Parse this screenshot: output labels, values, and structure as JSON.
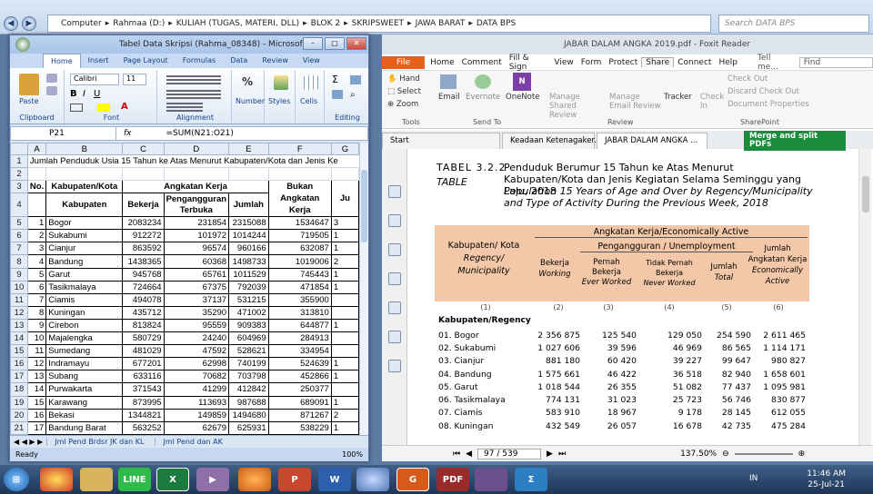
{
  "explorer": {
    "breadcrumb": [
      "Computer",
      "Rahmaa (D:)",
      "KULIAH (TUGAS, MATERI, DLL)",
      "BLOK 2",
      "SKRIPSWEET",
      "JAWA BARAT",
      "DATA BPS"
    ],
    "search_placeholder": "Search DATA BPS"
  },
  "excel": {
    "title": "Tabel Data Skripsi (Rahma_08348) - Microsoft E...",
    "tabs": [
      "Home",
      "Insert",
      "Page Layout",
      "Formulas",
      "Data",
      "Review",
      "View"
    ],
    "font_name": "Calibri",
    "font_size": "11",
    "groups": {
      "clipboard": "Clipboard",
      "font": "Font",
      "alignment": "Alignment",
      "editing": "Editing"
    },
    "paste": "Paste",
    "number": "Number",
    "styles": "Styles",
    "cells": "Cells",
    "cell_ref": "P21",
    "fx": "fx",
    "formula": "=SUM(N21:O21)",
    "columns": [
      "A",
      "B",
      "C",
      "D",
      "E",
      "F",
      "G"
    ],
    "row1_title": "Jumlah Penduduk Usia 15 Tahun ke Atas Menurut Kabupaten/Kota dan Jenis Ke",
    "head": {
      "no": "No.",
      "kabkota": "Kabupaten/Kota",
      "angkatan": "Angkatan Kerja",
      "kabupaten": "Kabupaten",
      "bekerja": "Bekerja",
      "pengangguran": "Pengangguran Terbuka",
      "jumlah": "Jumlah",
      "bukan": "Bukan Angkatan Kerja",
      "ju": "Ju"
    },
    "rows": [
      {
        "r": "5",
        "no": "1",
        "name": "Bogor",
        "c": "2083234",
        "d": "231854",
        "e": "2315088",
        "f": "1534647",
        "g": "3"
      },
      {
        "r": "6",
        "no": "2",
        "name": "Sukabumi",
        "c": "912272",
        "d": "101972",
        "e": "1014244",
        "f": "719505",
        "g": "1"
      },
      {
        "r": "7",
        "no": "3",
        "name": "Cianjur",
        "c": "863592",
        "d": "96574",
        "e": "960166",
        "f": "632087",
        "g": "1"
      },
      {
        "r": "8",
        "no": "4",
        "name": "Bandung",
        "c": "1438365",
        "d": "60368",
        "e": "1498733",
        "f": "1019006",
        "g": "2"
      },
      {
        "r": "9",
        "no": "5",
        "name": "Garut",
        "c": "945768",
        "d": "65761",
        "e": "1011529",
        "f": "745443",
        "g": "1"
      },
      {
        "r": "10",
        "no": "6",
        "name": "Tasikmalaya",
        "c": "724664",
        "d": "67375",
        "e": "792039",
        "f": "471854",
        "g": "1"
      },
      {
        "r": "11",
        "no": "7",
        "name": "Ciamis",
        "c": "494078",
        "d": "37137",
        "e": "531215",
        "f": "355900",
        "g": ""
      },
      {
        "r": "12",
        "no": "8",
        "name": "Kuningan",
        "c": "435712",
        "d": "35290",
        "e": "471002",
        "f": "313810",
        "g": ""
      },
      {
        "r": "13",
        "no": "9",
        "name": "Cirebon",
        "c": "813824",
        "d": "95559",
        "e": "909383",
        "f": "644877",
        "g": "1"
      },
      {
        "r": "14",
        "no": "10",
        "name": "Majalengka",
        "c": "580729",
        "d": "24240",
        "e": "604969",
        "f": "284913",
        "g": ""
      },
      {
        "r": "15",
        "no": "11",
        "name": "Sumedang",
        "c": "481029",
        "d": "47592",
        "e": "528621",
        "f": "334954",
        "g": ""
      },
      {
        "r": "16",
        "no": "12",
        "name": "Indramayu",
        "c": "677201",
        "d": "62998",
        "e": "740199",
        "f": "524639",
        "g": "1"
      },
      {
        "r": "17",
        "no": "13",
        "name": "Subang",
        "c": "633116",
        "d": "70682",
        "e": "703798",
        "f": "452866",
        "g": "1"
      },
      {
        "r": "18",
        "no": "14",
        "name": "Purwakarta",
        "c": "371543",
        "d": "41299",
        "e": "412842",
        "f": "250377",
        "g": ""
      },
      {
        "r": "19",
        "no": "15",
        "name": "Karawang",
        "c": "873995",
        "d": "113693",
        "e": "987688",
        "f": "689091",
        "g": "1"
      },
      {
        "r": "20",
        "no": "16",
        "name": "Bekasi",
        "c": "1344821",
        "d": "149859",
        "e": "1494680",
        "f": "871267",
        "g": "2"
      },
      {
        "r": "21",
        "no": "17",
        "name": "Bandung Barat",
        "c": "563252",
        "d": "62679",
        "e": "625931",
        "f": "538229",
        "g": "1"
      }
    ],
    "sheet_tabs": [
      "Jml Pend Brdsr JK dan KL",
      "Jml Pend dan AK"
    ],
    "status": "Ready",
    "zoom": "100%"
  },
  "foxit": {
    "title": "JABAR DALAM ANGKA 2019.pdf - Foxit Reader",
    "menu": [
      "File",
      "Home",
      "Comment",
      "Fill & Sign",
      "View",
      "Form",
      "Protect",
      "Share",
      "Connect",
      "Help"
    ],
    "tellme": "Tell me...",
    "find": "Find",
    "tools": {
      "hand": "Hand",
      "select": "Select",
      "zoom": "Zoom",
      "label": "Tools"
    },
    "sendto": {
      "email": "Email",
      "evernote": "Evernote",
      "onenote": "OneNote",
      "label": "Send To"
    },
    "review": {
      "shared": "Manage Shared Review",
      "email": "Manage Email Review",
      "tracker": "Tracker",
      "label": "Review"
    },
    "checkin": "Check In",
    "sharepoint": {
      "checkout": "Check Out",
      "discard": "Discard Check Out",
      "props": "Document Properties",
      "label": "SharePoint"
    },
    "tabs": [
      "Start",
      "Keadaan Ketenagaker...",
      "JABAR DALAM ANGKA ..."
    ],
    "merge": "Merge and split PDFs",
    "page": "97 / 539",
    "zoom": "137.50%",
    "pdf": {
      "table_no": "TABEL",
      "table_num": "3.2.2",
      "table_en": "TABLE",
      "title_id": "Penduduk Berumur 15 Tahun ke Atas Menurut Kabupaten/Kota dan Jenis Kegiatan Selama Seminggu yang Lalu, 2018",
      "title_en": "Population 15 Years of Age and Over by Regency/Municipality and Type of Activity During the Previous Week, 2018",
      "h_kab": "Kabupaten/ Kota",
      "h_kab_en": "Regency/ Municipality",
      "h_ak": "Angkatan Kerja/Economically Active",
      "h_peng": "Pengangguran / Unemployment",
      "h_bekerja": "Bekerja",
      "h_working": "Working",
      "h_pernah": "Pernah Bekerja",
      "h_pernah_en": "Ever Worked",
      "h_tidak": "Tidak Pernah Bekerja",
      "h_tidak_en": "Never Worked",
      "h_jumlah": "Jumlah",
      "h_total": "Total",
      "h_jak": "Jumlah Angkatan Kerja",
      "h_jak_en": "Economically Active",
      "colnums": [
        "(1)",
        "(2)",
        "(3)",
        "(4)",
        "(5)",
        "(6)"
      ],
      "section": "Kabupaten/Regency",
      "rows": [
        {
          "n": "01.  Bogor",
          "a": "2 356 875",
          "b": "125 540",
          "c": "129 050",
          "d": "254 590",
          "e": "2 611 465"
        },
        {
          "n": "02.  Sukabumi",
          "a": "1 027 606",
          "b": "39 596",
          "c": "46 969",
          "d": "86 565",
          "e": "1 114 171"
        },
        {
          "n": "03.  Cianjur",
          "a": "881 180",
          "b": "60 420",
          "c": "39 227",
          "d": "99 647",
          "e": "980 827"
        },
        {
          "n": "04.  Bandung",
          "a": "1 575 661",
          "b": "46 422",
          "c": "36 518",
          "d": "82 940",
          "e": "1 658 601"
        },
        {
          "n": "05.  Garut",
          "a": "1 018 544",
          "b": "26 355",
          "c": "51 082",
          "d": "77 437",
          "e": "1 095 981"
        },
        {
          "n": "06.  Tasikmalaya",
          "a": "774 131",
          "b": "31 023",
          "c": "25 723",
          "d": "56 746",
          "e": "830 877"
        },
        {
          "n": "07.  Ciamis",
          "a": "583 910",
          "b": "18 967",
          "c": "9 178",
          "d": "28 145",
          "e": "612 055"
        },
        {
          "n": "08.  Kuningan",
          "a": "432 549",
          "b": "26 057",
          "c": "16 678",
          "d": "42 735",
          "e": "475 284"
        }
      ]
    }
  },
  "taskbar": {
    "time": "11:46 AM",
    "date": "25-Jul-21",
    "lang": "IN"
  }
}
